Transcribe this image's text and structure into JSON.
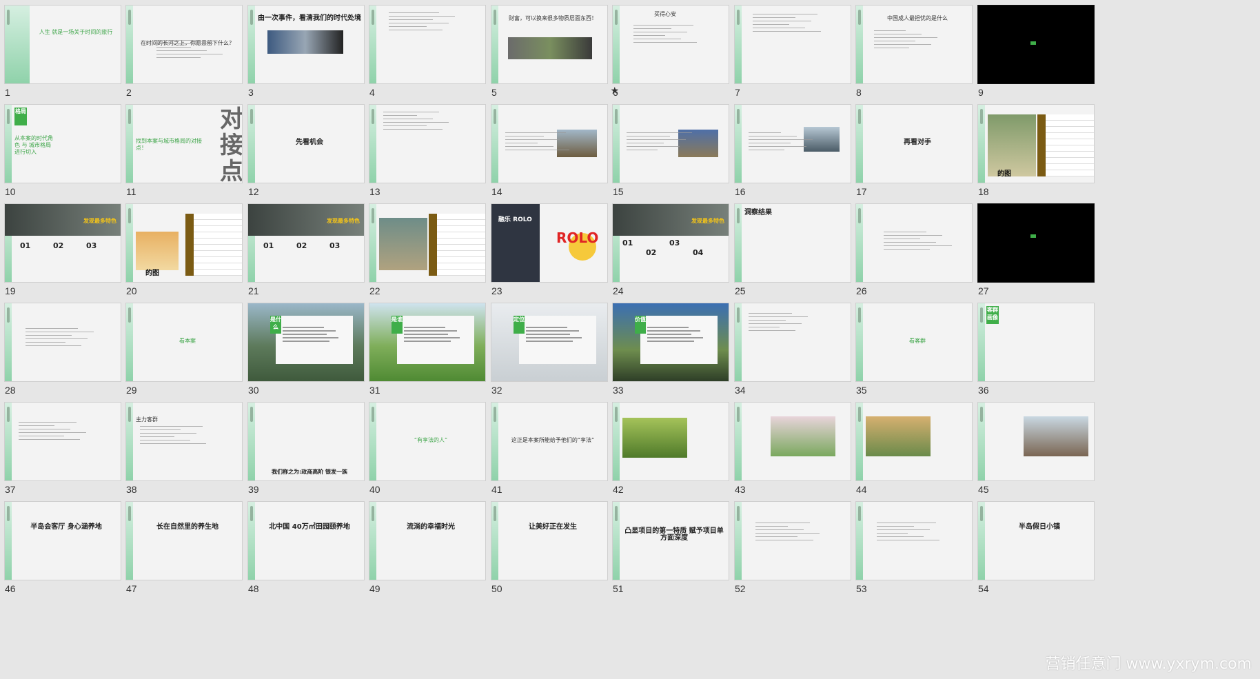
{
  "slides": [
    {
      "num": "1",
      "title": "人生 就是一场关于时间的旅行"
    },
    {
      "num": "2",
      "title": "在时间的长河之上，你愿意留下什么？"
    },
    {
      "num": "3",
      "title": "由一次事件，看清我们的时代处境"
    },
    {
      "num": "4",
      "title": ""
    },
    {
      "num": "5",
      "title": "财富，可以换来很多物质层面东西！",
      "marked": "★"
    },
    {
      "num": "6",
      "title": "买得心安"
    },
    {
      "num": "7",
      "title": ""
    },
    {
      "num": "8",
      "title": "中国成人最担忧的是什么"
    },
    {
      "num": "9",
      "title": ""
    },
    {
      "num": "10",
      "title": "从本案的时代角色 与 城市格局进行切入",
      "tag": "格局"
    },
    {
      "num": "11",
      "title": "找到本案与城市格局的对接点！",
      "big": "对接点"
    },
    {
      "num": "12",
      "title": "先看机会"
    },
    {
      "num": "13",
      "title": ""
    },
    {
      "num": "14",
      "title": ""
    },
    {
      "num": "15",
      "title": ""
    },
    {
      "num": "16",
      "title": ""
    },
    {
      "num": "17",
      "title": "再看对手"
    },
    {
      "num": "18",
      "title": "的图"
    },
    {
      "num": "19",
      "title": "发现最多特色",
      "items": [
        "01",
        "02",
        "03"
      ]
    },
    {
      "num": "20",
      "title": "的图"
    },
    {
      "num": "21",
      "title": "发现最多特色",
      "items": [
        "01",
        "02",
        "03"
      ]
    },
    {
      "num": "22",
      "title": ""
    },
    {
      "num": "23",
      "title": "融乐 ROLO",
      "logo": "ROLO"
    },
    {
      "num": "24",
      "title": "发现最多特色",
      "items": [
        "01",
        "02",
        "03",
        "04"
      ]
    },
    {
      "num": "25",
      "title": "洞察结果"
    },
    {
      "num": "26",
      "title": ""
    },
    {
      "num": "27",
      "title": ""
    },
    {
      "num": "28",
      "title": ""
    },
    {
      "num": "29",
      "title": "看本案"
    },
    {
      "num": "30",
      "title": "",
      "tag": "是什么"
    },
    {
      "num": "31",
      "title": "",
      "tag": "是谁"
    },
    {
      "num": "32",
      "title": "",
      "tag": "定位"
    },
    {
      "num": "33",
      "title": "",
      "tag": "价值"
    },
    {
      "num": "34",
      "title": ""
    },
    {
      "num": "35",
      "title": "看客群"
    },
    {
      "num": "36",
      "title": "",
      "tag": "客群 画像"
    },
    {
      "num": "37",
      "title": ""
    },
    {
      "num": "38",
      "title": "主力客群"
    },
    {
      "num": "39",
      "title": "我们称之为:政商高阶 银发一族"
    },
    {
      "num": "40",
      "title": "“有享法的人”"
    },
    {
      "num": "41",
      "title": "这正是本案所能给予他们的“享法”"
    },
    {
      "num": "42",
      "title": ""
    },
    {
      "num": "43",
      "title": ""
    },
    {
      "num": "44",
      "title": ""
    },
    {
      "num": "45",
      "title": ""
    },
    {
      "num": "46",
      "title": "半岛会客厅 身心涵养地"
    },
    {
      "num": "47",
      "title": "长在自然里的养生地"
    },
    {
      "num": "48",
      "title": "北中国 40万㎡田园颐养地"
    },
    {
      "num": "49",
      "title": "流淌的幸福时光"
    },
    {
      "num": "50",
      "title": "让美好正在发生"
    },
    {
      "num": "51",
      "title": "凸显项目的第一特质 赋予项目单方面深度"
    },
    {
      "num": "52",
      "title": ""
    },
    {
      "num": "53",
      "title": ""
    },
    {
      "num": "54",
      "title": "半岛假日小镇"
    }
  ],
  "watermark": "营销任意门 www.yxrym.com",
  "colors": {
    "accent": "#3fae49",
    "background": "#e6e6e6"
  }
}
